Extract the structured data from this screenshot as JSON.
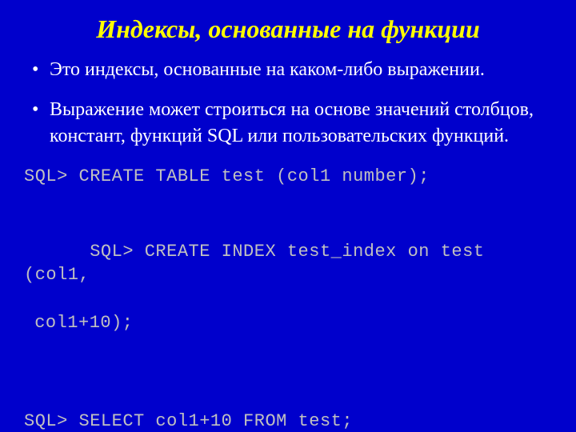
{
  "title": "Индексы, основанные на функции",
  "bullets": [
    "Это индексы, основанные на каком-либо выражении.",
    "Выражение может строиться на основе значений столбцов, констант, функций SQL или пользовательских функций."
  ],
  "code": {
    "line1": "SQL> CREATE TABLE test (col1 number);",
    "line2a": "SQL> CREATE INDEX test_index on test (col1,",
    "line2b": "col1+10);",
    "line3": "SQL> SELECT col1+10 FROM test;"
  }
}
